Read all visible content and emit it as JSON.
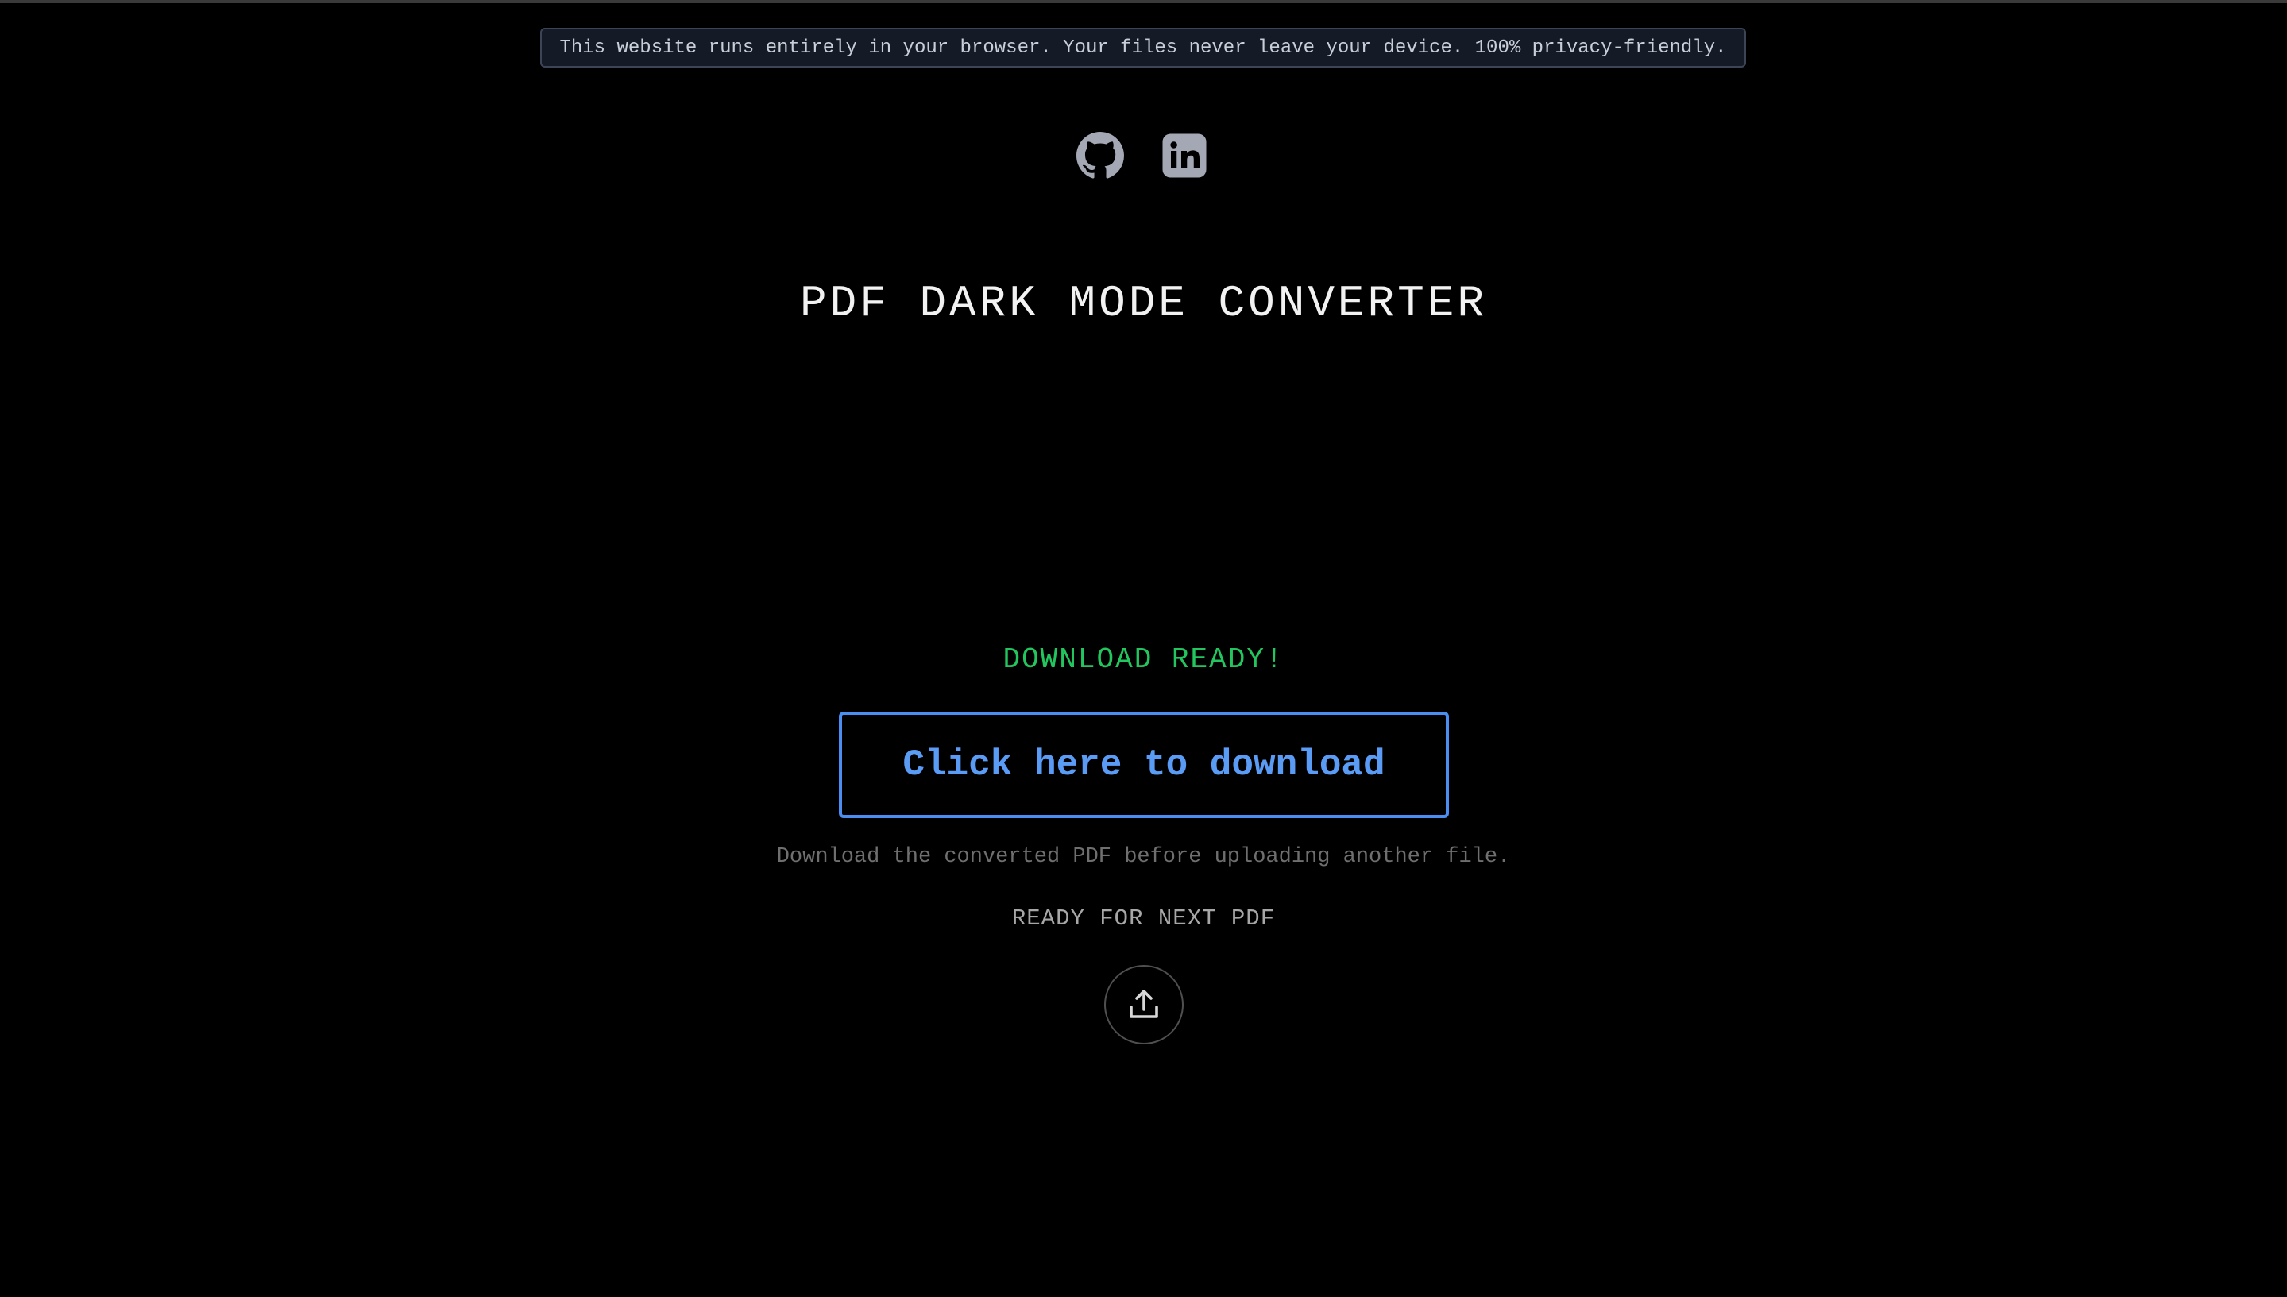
{
  "banner": {
    "text": "This website runs entirely in your browser. Your files never leave your device. 100% privacy-friendly."
  },
  "social": {
    "items": [
      {
        "icon": "github-icon",
        "color": "#a3a8b4"
      },
      {
        "icon": "linkedin-icon",
        "color": "#a3a8b4"
      }
    ]
  },
  "header": {
    "title": "PDF DARK MODE CONVERTER"
  },
  "download": {
    "status": "DOWNLOAD READY!",
    "button_label": "Click here to download",
    "hint": "Download the converted PDF before uploading another file."
  },
  "upload": {
    "status": "READY FOR NEXT PDF",
    "icon": "upload-icon"
  },
  "colors": {
    "background": "#000000",
    "accent": "#4a8ef2",
    "success": "#22c55e"
  }
}
